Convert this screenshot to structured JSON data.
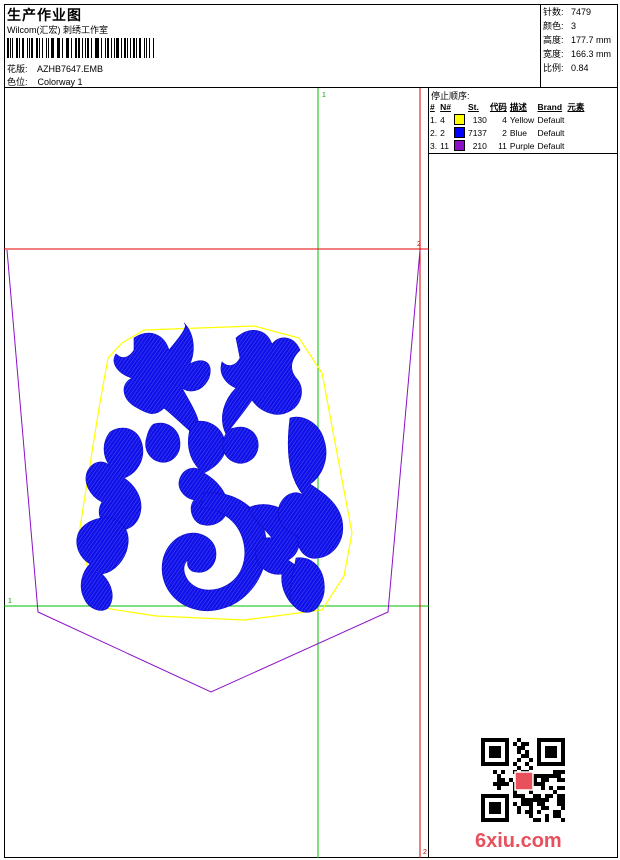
{
  "header": {
    "title": "生产作业图",
    "subtitle": "Wilcom(汇宏) 刺绣工作室",
    "design_label": "花版:",
    "design_value": "AZHB7647.EMB",
    "colorway_label": "色位:",
    "colorway_value": "Colorway 1"
  },
  "stats": [
    {
      "label": "针数:",
      "value": "7479"
    },
    {
      "label": "颜色:",
      "value": "3"
    },
    {
      "label": "高度:",
      "value": "177.7 mm"
    },
    {
      "label": "宽度:",
      "value": "166.3 mm"
    },
    {
      "label": "比例:",
      "value": "0.84"
    }
  ],
  "stop_sequence": {
    "title": "停止顺序:",
    "headers": [
      "#",
      "N#",
      "St.",
      "代码",
      "描述",
      "Brand",
      "元素"
    ],
    "rows": [
      {
        "idx": "1.",
        "n": "4",
        "color": "#FFFF00",
        "st": "130",
        "code": "4",
        "desc": "Yellow",
        "brand": "Default"
      },
      {
        "idx": "2.",
        "n": "2",
        "color": "#0000FF",
        "st": "7137",
        "code": "2",
        "desc": "Blue",
        "brand": "Default"
      },
      {
        "idx": "3.",
        "n": "11",
        "color": "#8B10C8",
        "st": "210",
        "code": "11",
        "desc": "Purple",
        "brand": "Default"
      }
    ]
  },
  "canvas": {
    "guide_v_label": "1",
    "guide_h_label": "1",
    "guide_top_label": "2",
    "guide_bottom_label": "2",
    "colors": {
      "guide_green": "#00C000",
      "guide_red": "#E00000",
      "outline_purple": "#8B10C8",
      "outline_yellow": "#FFFF00",
      "stitch_blue": "#1010E8"
    }
  },
  "watermark": {
    "site_text": "6xiu.com",
    "qr_icon": "qr-code-icon"
  }
}
